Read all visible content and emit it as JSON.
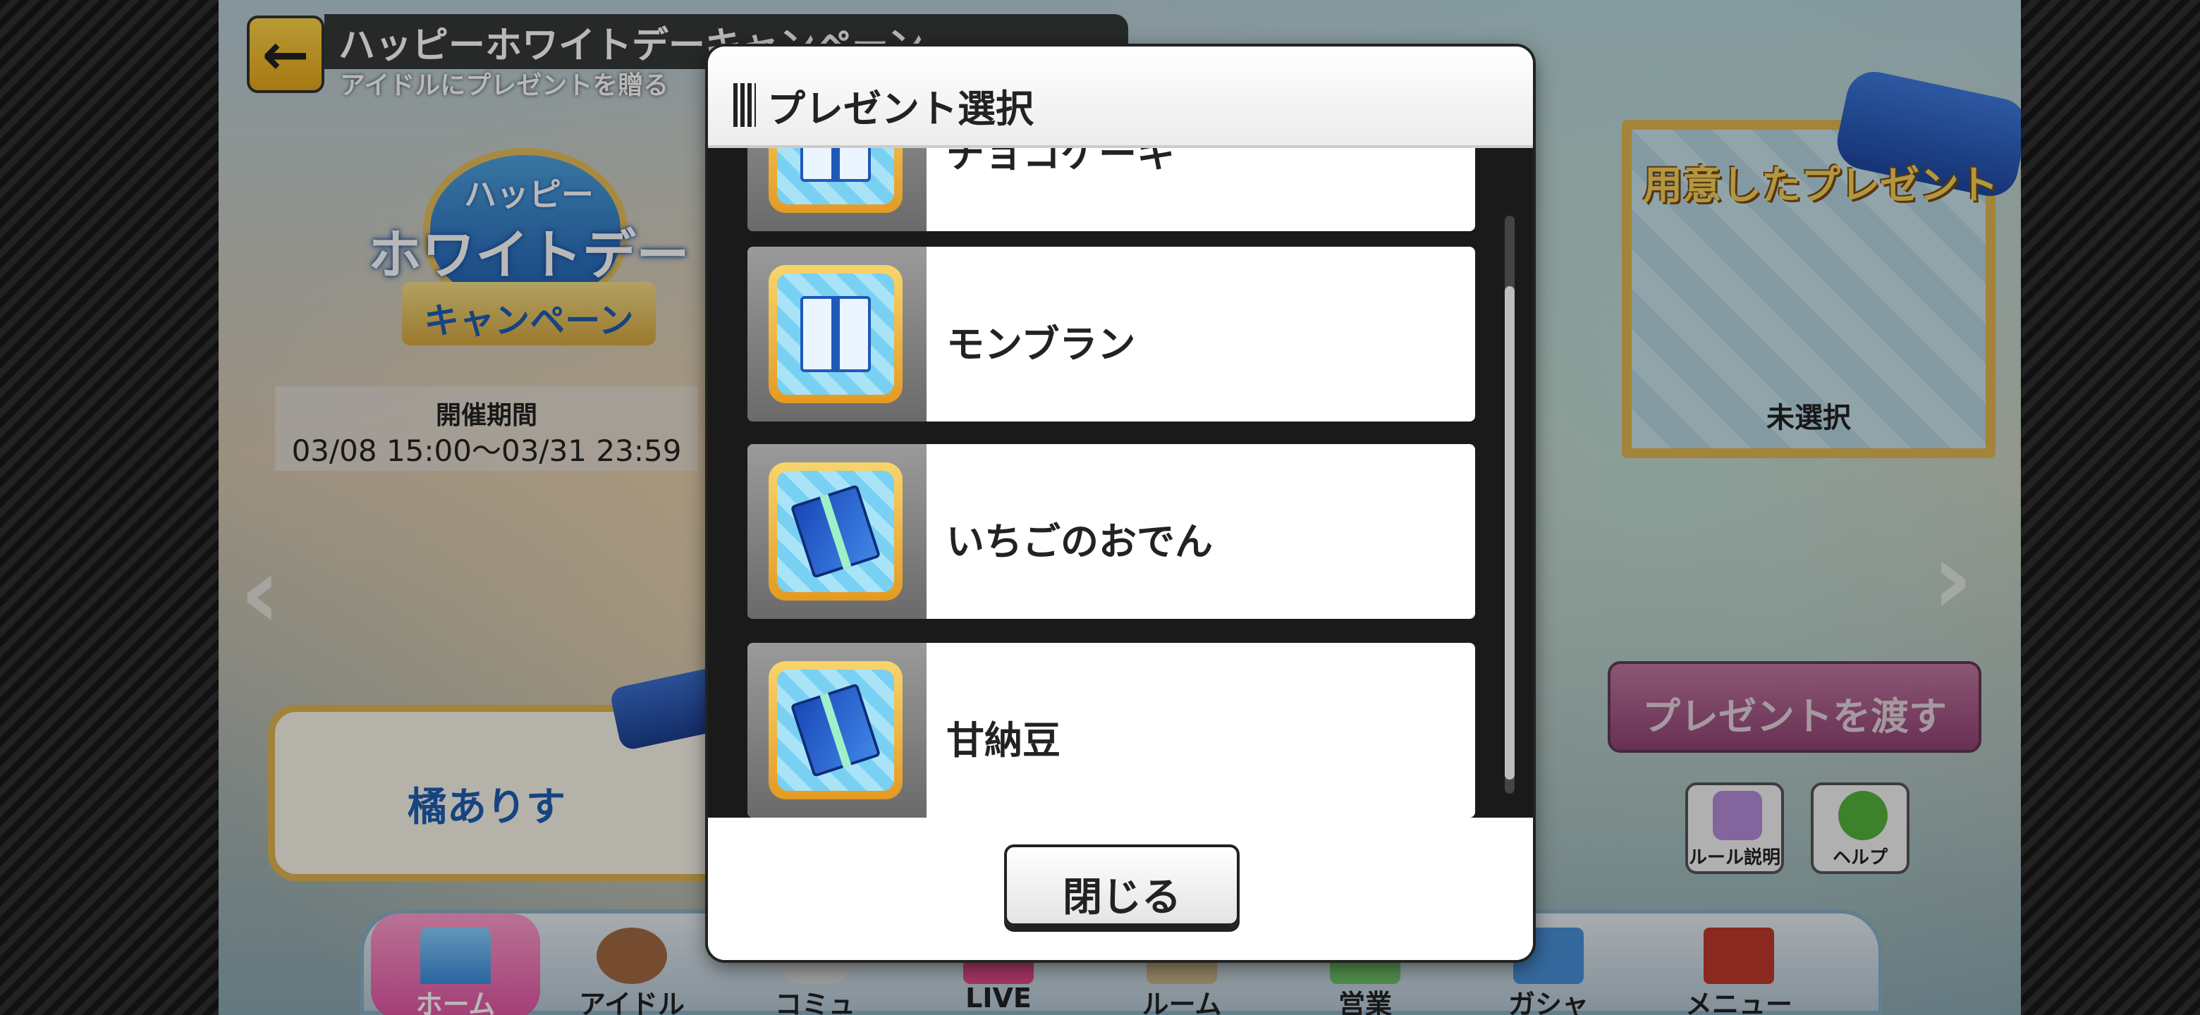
{
  "header": {
    "title": "ハッピーホワイトデーキャンペーン",
    "subtitle": "アイドルにプレゼントを贈る"
  },
  "campaign_logo": {
    "line1": "ハッピー",
    "line2": "ホワイトデー",
    "line3": "キャンペーン"
  },
  "period": {
    "label": "開催期間",
    "value": "03/08 15:00～03/31 23:59"
  },
  "idol": {
    "name": "橘ありす"
  },
  "prepared_present": {
    "title": "用意したプレゼント",
    "status": "未選択"
  },
  "give_button": {
    "label": "プレゼントを渡す"
  },
  "utility_buttons": [
    {
      "label": "ルール説明",
      "icon": "rules-clipboard-icon",
      "color": "#b48cd8"
    },
    {
      "label": "ヘルプ",
      "icon": "help-question-icon",
      "color": "#57b33e"
    }
  ],
  "nav": [
    {
      "label": "ホーム",
      "icon": "castle-icon"
    },
    {
      "label": "アイドル",
      "icon": "idol-portrait-icon"
    },
    {
      "label": "コミュ",
      "icon": "commu-icon"
    },
    {
      "label": "LIVE",
      "icon": "live-icon"
    },
    {
      "label": "ルーム",
      "icon": "room-icon"
    },
    {
      "label": "営業",
      "icon": "business-icon"
    },
    {
      "label": "ガシャ",
      "icon": "gacha-icon"
    },
    {
      "label": "メニュー",
      "icon": "menu-book-icon"
    }
  ],
  "modal": {
    "title": "プレゼント選択",
    "items": [
      {
        "label": "チョコケーキ",
        "icon": "gift-box-white-icon"
      },
      {
        "label": "モンブラン",
        "icon": "gift-box-white-icon"
      },
      {
        "label": "いちごのおでん",
        "icon": "gift-box-blue-icon"
      },
      {
        "label": "甘納豆",
        "icon": "gift-box-blue-icon"
      }
    ],
    "close_label": "閉じる"
  }
}
